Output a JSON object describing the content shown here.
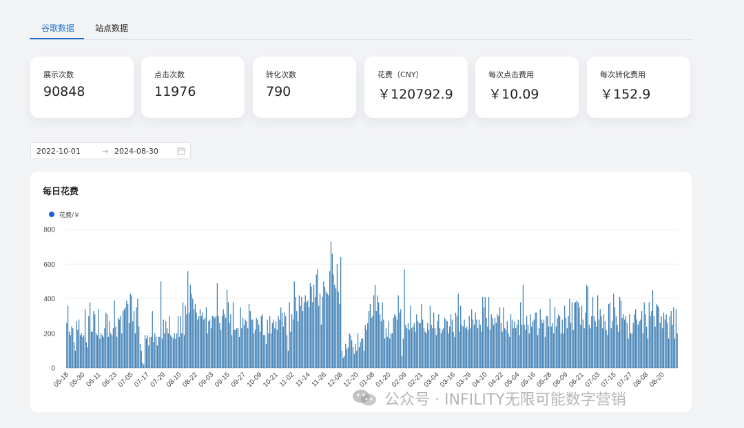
{
  "tabs": [
    {
      "label": "谷歌数据",
      "active": true
    },
    {
      "label": "站点数据",
      "active": false
    }
  ],
  "stats": [
    {
      "label": "展示次数",
      "value": "90848"
    },
    {
      "label": "点击次数",
      "value": "11976"
    },
    {
      "label": "转化次数",
      "value": "790"
    },
    {
      "label": "花费（CNY）",
      "value": "￥120792.9"
    },
    {
      "label": "每次点击费用",
      "value": "￥10.09"
    },
    {
      "label": "每次转化费用",
      "value": "￥152.9"
    }
  ],
  "date_range": {
    "start": "2022-10-01",
    "separator": "→",
    "end": "2024-08-30",
    "icon": "calendar-icon"
  },
  "chart_panel": {
    "title": "每日花费"
  },
  "watermark": {
    "text": "公众号 · INFILITY无限可能数字营销",
    "icon": "wechat-icon"
  },
  "colors": {
    "accent": "#1f6fd1",
    "bar": "#1f6aa8",
    "legend_dot": "#1f5fd6"
  },
  "chart_data": {
    "type": "bar",
    "title": "每日花费",
    "legend": [
      "花费/￥"
    ],
    "legend_position": "top-left",
    "grid": true,
    "ylim": [
      0,
      800
    ],
    "yticks": [
      0,
      200,
      400,
      600,
      800
    ],
    "x_tick_labels": [
      "05-18",
      "05-30",
      "06-11",
      "06-23",
      "07-05",
      "07-17",
      "07-29",
      "08-10",
      "08-22",
      "09-03",
      "09-15",
      "09-27",
      "10-09",
      "10-21",
      "11-02",
      "11-14",
      "11-26",
      "12-08",
      "12-20",
      "01-08",
      "01-20",
      "02-09",
      "02-21",
      "03-04",
      "03-16",
      "03-29",
      "04-10",
      "04-22",
      "05-04",
      "05-16",
      "05-28",
      "06-09",
      "06-21",
      "07-03",
      "07-15",
      "07-27",
      "08-08",
      "08-20"
    ],
    "series": [
      {
        "name": "花费/￥",
        "values": [
          260,
          360,
          210,
          190,
          240,
          230,
          150,
          100,
          270,
          220,
          280,
          190,
          200,
          180,
          190,
          340,
          150,
          120,
          300,
          380,
          210,
          210,
          330,
          310,
          200,
          190,
          340,
          170,
          200,
          190,
          180,
          230,
          320,
          310,
          180,
          270,
          200,
          190,
          230,
          390,
          240,
          180,
          290,
          280,
          300,
          200,
          330,
          340,
          350,
          390,
          370,
          260,
          430,
          420,
          270,
          330,
          200,
          350,
          400,
          240,
          140,
          100,
          30,
          20,
          190,
          170,
          190,
          130,
          180,
          180,
          330,
          150,
          200,
          180,
          130,
          180,
          180,
          500,
          170,
          280,
          200,
          270,
          230,
          200,
          300,
          190,
          180,
          170,
          200,
          170,
          200,
          300,
          180,
          300,
          200,
          380,
          190,
          360,
          310,
          560,
          320,
          480,
          430,
          400,
          340,
          370,
          320,
          280,
          300,
          340,
          300,
          320,
          280,
          290,
          350,
          200,
          270,
          280,
          230,
          300,
          300,
          290,
          300,
          490,
          300,
          260,
          220,
          300,
          340,
          310,
          290,
          450,
          380,
          260,
          310,
          190,
          380,
          220,
          220,
          230,
          230,
          180,
          350,
          230,
          290,
          250,
          280,
          270,
          230,
          370,
          330,
          280,
          280,
          200,
          220,
          290,
          280,
          250,
          210,
          300,
          310,
          190,
          190,
          140,
          280,
          200,
          300,
          200,
          260,
          280,
          230,
          270,
          220,
          300,
          280,
          350,
          320,
          240,
          320,
          300,
          190,
          100,
          380,
          210,
          310,
          280,
          500,
          410,
          330,
          270,
          420,
          360,
          410,
          330,
          380,
          420,
          380,
          390,
          350,
          490,
          470,
          380,
          480,
          410,
          540,
          570,
          360,
          430,
          250,
          410,
          500,
          470,
          440,
          430,
          420,
          560,
          730,
          660,
          540,
          480,
          460,
          600,
          440,
          370,
          640,
          100,
          60,
          70,
          140,
          110,
          120,
          200,
          190,
          160,
          120,
          80,
          140,
          100,
          200,
          120,
          150,
          170,
          170,
          100,
          250,
          220,
          260,
          330,
          370,
          290,
          300,
          420,
          480,
          330,
          420,
          380,
          310,
          270,
          380,
          280,
          170,
          230,
          180,
          270,
          170,
          200,
          200,
          290,
          310,
          300,
          280,
          420,
          320,
          340,
          70,
          170,
          570,
          250,
          230,
          260,
          220,
          360,
          230,
          240,
          260,
          210,
          310,
          270,
          260,
          260,
          370,
          280,
          230,
          210,
          200,
          260,
          220,
          360,
          250,
          230,
          320,
          230,
          190,
          270,
          310,
          230,
          200,
          220,
          230,
          290,
          280,
          270,
          200,
          240,
          310,
          280,
          210,
          180,
          320,
          300,
          430,
          210,
          360,
          250,
          240,
          280,
          230,
          240,
          220,
          300,
          230,
          340,
          280,
          250,
          320,
          280,
          230,
          280,
          250,
          210,
          410,
          350,
          410,
          290,
          240,
          410,
          220,
          310,
          290,
          250,
          290,
          260,
          310,
          300,
          350,
          260,
          210,
          350,
          230,
          220,
          270,
          200,
          180,
          310,
          280,
          230,
          270,
          230,
          250,
          280,
          190,
          380,
          250,
          480,
          250,
          220,
          300,
          250,
          200,
          310,
          240,
          270,
          280,
          320,
          320,
          190,
          230,
          340,
          280,
          260,
          280,
          180,
          300,
          300,
          240,
          400,
          240,
          260,
          200,
          350,
          240,
          290,
          310,
          300,
          200,
          280,
          200,
          360,
          290,
          230,
          300,
          400,
          260,
          380,
          220,
          380,
          380,
          390,
          380,
          350,
          250,
          360,
          280,
          230,
          320,
          480,
          470,
          250,
          230,
          300,
          410,
          300,
          270,
          240,
          420,
          280,
          340,
          300,
          230,
          310,
          270,
          220,
          190,
          370,
          380,
          230,
          270,
          430,
          350,
          300,
          250,
          210,
          410,
          390,
          290,
          310,
          280,
          300,
          260,
          170,
          310,
          200,
          200,
          260,
          310,
          340,
          280,
          250,
          270,
          280,
          330,
          200,
          380,
          310,
          240,
          170,
          380,
          300,
          330,
          450,
          300,
          240,
          370,
          360,
          350,
          260,
          300,
          230,
          320,
          280,
          310,
          260,
          170,
          300,
          330,
          250,
          350,
          170,
          340,
          200
        ]
      }
    ]
  }
}
